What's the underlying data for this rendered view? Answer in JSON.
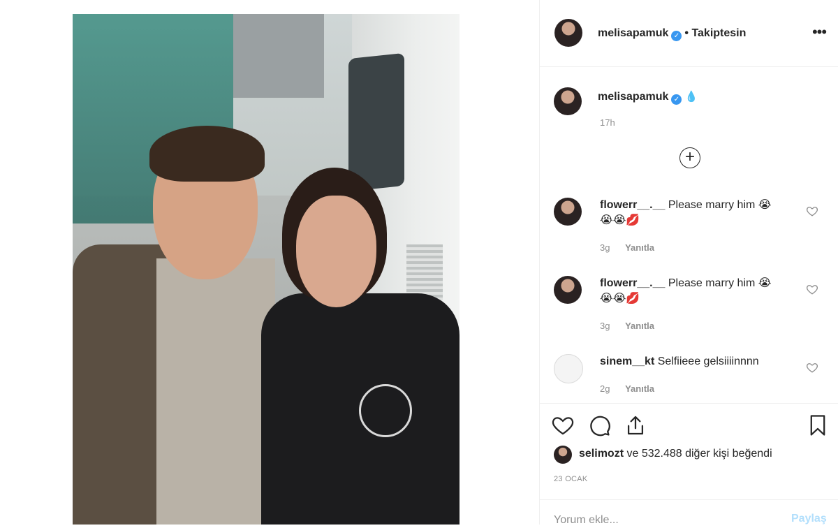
{
  "post": {
    "author": "melisapamuk",
    "follow_state": "• Takiptesin",
    "more_label": "•••",
    "caption_emoji": "💧",
    "caption_time": "17h",
    "load_more_label": "+"
  },
  "comments": [
    {
      "user": "flowerr__.__",
      "text": "Please marry him 😭",
      "text2": "😭😭💋",
      "age": "3g",
      "reply": "Yanıtla"
    },
    {
      "user": "flowerr__.__",
      "text": "Please marry him 😭",
      "text2": "😭😭💋",
      "age": "3g",
      "reply": "Yanıtla"
    },
    {
      "user": "sinem__kt",
      "text": "Selfiieee gelsiiiinnnn",
      "text2": "",
      "age": "2g",
      "reply": "Yanıtla"
    }
  ],
  "likes": {
    "liker": "selimozt",
    "rest": "ve 532.488 diğer kişi beğendi"
  },
  "date": "23 OCAK",
  "comment_box": {
    "placeholder": "Yorum ekle...",
    "share_label": "Paylaş"
  },
  "icons": {
    "verified": "verified-badge-icon",
    "like": "heart-icon",
    "comment": "speech-bubble-icon",
    "share": "share-icon",
    "save": "bookmark-icon"
  },
  "colors": {
    "verified_blue": "#3897f0",
    "muted_text": "#8e8e8e",
    "share_disabled": "#b2dffc"
  }
}
